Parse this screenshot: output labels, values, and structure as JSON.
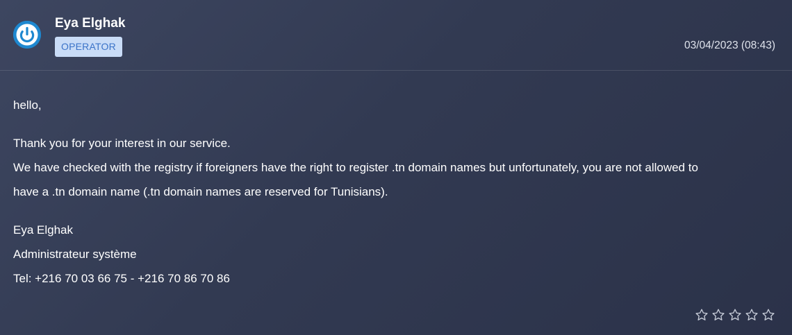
{
  "message": {
    "author": "Eya Elghak",
    "role_badge": "OPERATOR",
    "timestamp": "03/04/2023 (08:43)",
    "greeting": "hello,",
    "paragraph_lines": [
      "Thank you for your interest in our service.",
      "We have checked with the registry if foreigners have the right to register .tn domain names but unfortunately, you are not allowed to",
      "have a .tn domain name (.tn domain names are reserved for Tunisians)."
    ],
    "signature": [
      "Eya Elghak",
      "Administrateur système",
      "Tel: +216 70 03 66 75 - +216 70 86 70 86"
    ]
  },
  "rating": {
    "value": 0,
    "max": 5,
    "icon": "star-outline-icon"
  },
  "colors": {
    "avatar": "#1e88d0",
    "badge_bg": "#c9dcf7",
    "badge_text": "#3b73c8",
    "background": "#353d56"
  }
}
